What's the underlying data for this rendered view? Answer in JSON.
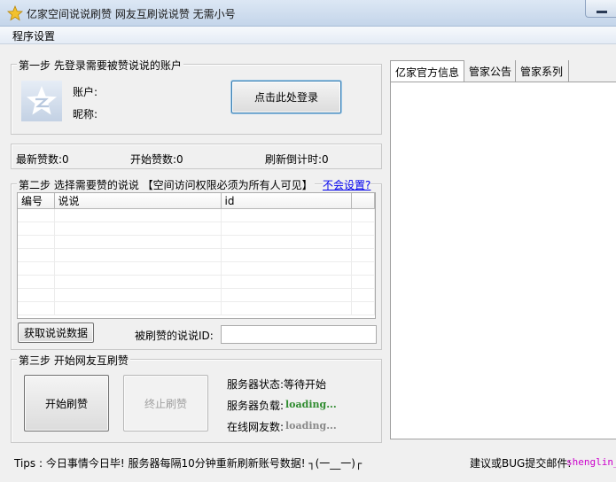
{
  "window": {
    "title": "亿家空间说说刷赞 网友互刷说说赞 无需小号",
    "minimize_icon": "minimize-icon",
    "app_icon": "star-icon",
    "accent": "#dce7f4"
  },
  "menu": {
    "items": [
      "程序设置"
    ]
  },
  "step1": {
    "legend": "第一步 先登录需要被赞说说的账户",
    "avatar_icon": "qq-zone-star-icon",
    "account_label": "账户:",
    "nickname_label": "昵称:",
    "login_button": "点击此处登录"
  },
  "stats": {
    "latest_likes": "最新赞数:0",
    "start_likes": "开始赞数:0",
    "countdown": "刷新倒计时:0"
  },
  "step2": {
    "legend": "第二步 选择需要赞的说说 【空间访问权限必须为所有人可见】",
    "help_link": "不会设置?",
    "columns": [
      "编号",
      "说说",
      "id"
    ],
    "rows": [],
    "fetch_button": "获取说说数据",
    "post_id_label": "被刷赞的说说ID:",
    "post_id_value": ""
  },
  "step3": {
    "legend": "第三步 开始网友互刷赞",
    "start_button": "开始刷赞",
    "stop_button": "终止刷赞",
    "server_status": "服务器状态:等待开始",
    "server_load_label": "服务器负载:",
    "server_load_value": "loading...",
    "online_label": "在线网友数:",
    "online_value": "loading...",
    "loading_color": "#2e8b2e",
    "loading_color_dim": "#888888"
  },
  "right_tabs": {
    "tabs": [
      "亿家官方信息",
      "管家公告",
      "管家系列"
    ],
    "active": 0
  },
  "status": {
    "tips": "Tips : 今日事情今日毕! 服务器每隔10分钟重新刷新账号数据! ┐(一__一)┌",
    "feedback_label": "建议或BUG提交邮件:",
    "email": "shenglin_y",
    "email_color": "#cc00cc"
  }
}
